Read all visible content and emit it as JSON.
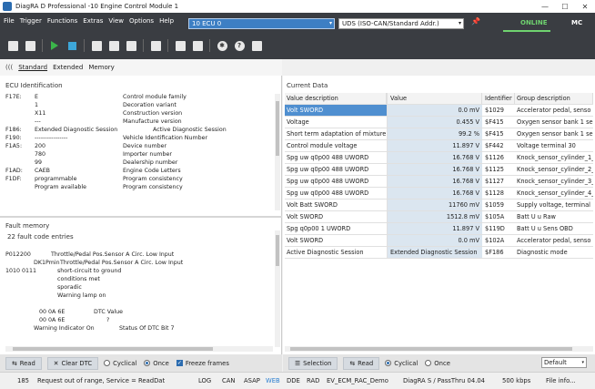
{
  "window": {
    "title": "DiagRA D Professional -10   Engine Control Module 1",
    "minimize": "—",
    "maximize": "☐",
    "close": "✕"
  },
  "menu": [
    "File",
    "Trigger",
    "Functions",
    "Extras",
    "View",
    "Options",
    "Help"
  ],
  "ecu_select": {
    "value": "10  ECU 0",
    "arrow": "▾"
  },
  "protocol_select": {
    "value": "UDS (ISO-CAN/Standard Addr.)",
    "arrow": "▾"
  },
  "pin_icon": "📌",
  "connection": {
    "status": "ONLINE",
    "mode": "MC",
    "status_color": "#6fd36f"
  },
  "toolbar_icons": [
    "new-icon",
    "save-icon",
    "play-icon",
    "stop-icon",
    "camera-icon",
    "copy-icon",
    "clipboard-icon",
    "display-icon",
    "flash-icon",
    "export-icon",
    "settings-icon",
    "help-icon",
    "info-icon"
  ],
  "tabs": {
    "wifi": "(((",
    "items": [
      "Standard",
      "Extended",
      "Memory"
    ],
    "active": "Standard"
  },
  "ecu_identification": {
    "title": "ECU Identification",
    "rows": [
      [
        "F17E:",
        "E",
        "Control module family"
      ],
      [
        "",
        "1",
        "Decoration variant"
      ],
      [
        "",
        "X11",
        "Construction version"
      ],
      [
        "",
        "---",
        "Manufacture version"
      ],
      [
        "F186:",
        "Extended Diagnostic Session",
        "Active Diagnostic Session"
      ],
      [
        "F190:",
        "----------------",
        "Vehicle Identification Number"
      ],
      [
        "F1A5:",
        "200",
        "Device number"
      ],
      [
        "",
        "780",
        "Importer number"
      ],
      [
        "",
        "99",
        "Dealership number"
      ],
      [
        "F1AD:",
        "CAEB",
        "Engine Code Letters"
      ],
      [
        "F1DF:",
        "programmable",
        "Program consistency"
      ],
      [
        "",
        "Program available",
        "Program consistency"
      ]
    ]
  },
  "fault_memory": {
    "title": "Fault memory",
    "count_text": "22 fault code entries",
    "lines": [
      [
        "P012200",
        "Throttle/Pedal Pos.Sensor A Circ. Low Input"
      ],
      [
        "DK1Pmin",
        "Throttle/Pedal Pos.Sensor A Circ. Low Input"
      ],
      [
        "1010 0111",
        "short-circuit to ground"
      ],
      [
        "",
        "conditions met"
      ],
      [
        "",
        "sporadic"
      ],
      [
        "",
        "Warning lamp on"
      ],
      [
        "",
        ""
      ],
      [
        "00 0A 6E",
        "DTC Value"
      ],
      [
        "00 0A 6E",
        "?"
      ],
      [
        "Warning Indicator On",
        "Status Of DTC Bit 7"
      ]
    ]
  },
  "current_data": {
    "title": "Current Data",
    "columns": [
      "Value description",
      "Value",
      "Identifier",
      "Group description"
    ],
    "rows": [
      [
        "Volt SWORD",
        "0.0 mV",
        "$1029",
        "Accelerator pedal, senso"
      ],
      [
        "Voltage",
        "0.455 V",
        "$F415",
        "Oxygen sensor bank 1 se"
      ],
      [
        "Short term adaptation of mixture",
        "99.2 %",
        "$F415",
        "Oxygen sensor bank 1 se"
      ],
      [
        "Control module voltage",
        "11.897 V",
        "$F442",
        "Voltage terminal 30"
      ],
      [
        "Spg uw q0p00 488 UWORD",
        "16.768 V",
        "$1126",
        "Knock_sensor_cylinder_1_"
      ],
      [
        "Spg uw q0p00 488 UWORD",
        "16.768 V",
        "$1125",
        "Knock_sensor_cylinder_2_"
      ],
      [
        "Spg uw q0p00 488 UWORD",
        "16.768 V",
        "$1127",
        "Knock_sensor_cylinder_3_"
      ],
      [
        "Spg uw q0p00 488 UWORD",
        "16.768 V",
        "$1128",
        "Knock_sensor_cylinder_4_"
      ],
      [
        "Volt Batt SWORD",
        "11760 mV",
        "$1059",
        "Supply voltage, terminal"
      ],
      [
        "Volt SWORD",
        "1512.8 mV",
        "$105A",
        "Batt U u Raw"
      ],
      [
        "Spg q0p00 1 UWORD",
        "11.897 V",
        "$119D",
        "Batt U u Sens OBD"
      ],
      [
        "Volt SWORD",
        "0.0 mV",
        "$102A",
        "Accelerator pedal, senso"
      ],
      [
        "Active Diagnostic Session",
        "Extended Diagnostic Session",
        "$F186",
        "Diagnostic mode"
      ]
    ]
  },
  "left_controls": {
    "read": "Read",
    "clear_dtc": "Clear DTC",
    "cyclical": "Cyclical",
    "once": "Once",
    "freeze": "Freeze frames"
  },
  "right_controls": {
    "selection": "Selection",
    "read": "Read",
    "cyclical": "Cyclical",
    "once": "Once",
    "default": "Default",
    "arrow": "▾"
  },
  "status_bar": {
    "code": "185",
    "message": "Request out of range, Service = ReadDat",
    "indicators": [
      "LOG",
      "CAN",
      "ASAP",
      "WEB",
      "DDE",
      "RAD"
    ],
    "project": "EV_ECM_RAC_Demo",
    "interface": "DiagRA S / PassThru 04.04",
    "baud": "500 kbps",
    "info": "File info..."
  }
}
